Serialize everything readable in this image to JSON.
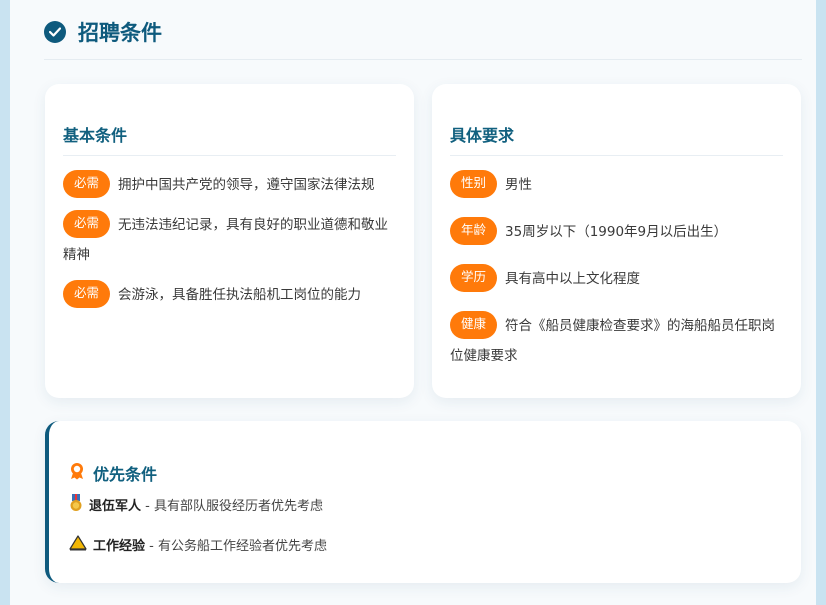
{
  "section": {
    "title": "招聘条件"
  },
  "basic": {
    "title": "基本条件",
    "items": [
      {
        "badge": "必需",
        "text": "拥护中国共产党的领导，遵守国家法律法规"
      },
      {
        "badge": "必需",
        "text": "无违法违纪记录，具有良好的职业道德和敬业精神"
      },
      {
        "badge": "必需",
        "text": "会游泳，具备胜任执法船机工岗位的能力"
      }
    ]
  },
  "specific": {
    "title": "具体要求",
    "items": [
      {
        "badge": "性别",
        "text": "男性"
      },
      {
        "badge": "年龄",
        "text": "35周岁以下（1990年9月以后出生）"
      },
      {
        "badge": "学历",
        "text": "具有高中以上文化程度"
      },
      {
        "badge": "健康",
        "text": "符合《船员健康检查要求》的海船船员任职岗位健康要求"
      }
    ]
  },
  "priority": {
    "title": "优先条件",
    "items": [
      {
        "icon": "medal-icon",
        "label": "退伍军人",
        "text": " - 具有部队服役经历者优先考虑"
      },
      {
        "icon": "warning-icon",
        "label": "工作经验",
        "text": " - 有公务船工作经验者优先考虑"
      }
    ]
  },
  "colors": {
    "primary": "#0e5a7d",
    "badge": "#ff7a0a"
  }
}
